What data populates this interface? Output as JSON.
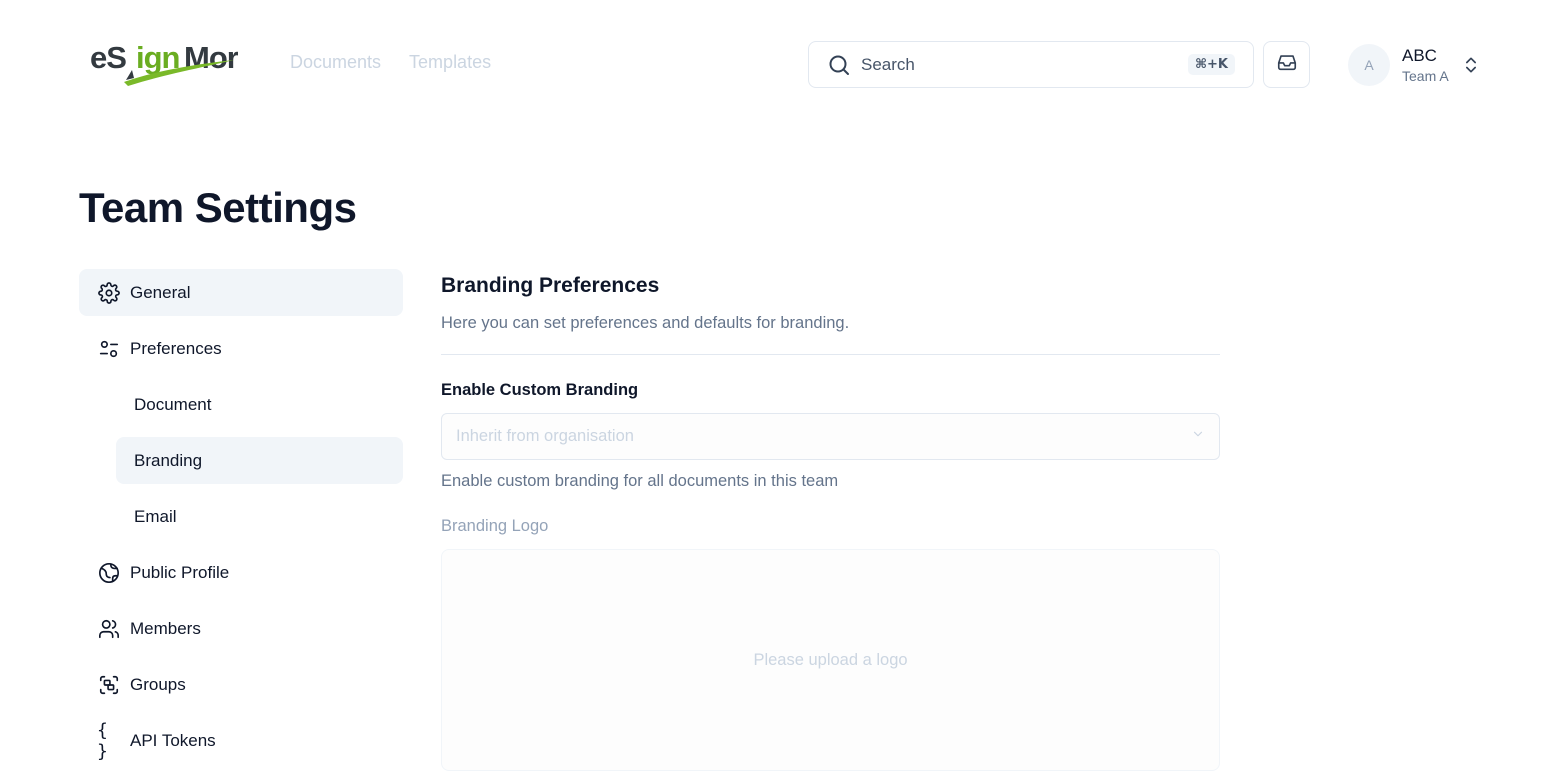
{
  "header": {
    "logo_text": "eSignMor",
    "nav": [
      {
        "label": "Documents"
      },
      {
        "label": "Templates"
      }
    ],
    "search": {
      "label": "Search",
      "shortcut": "⌘+K"
    },
    "account": {
      "avatar_initial": "A",
      "name": "ABC",
      "team": "Team A"
    }
  },
  "page": {
    "title": "Team Settings"
  },
  "sidebar": {
    "items": [
      {
        "label": "General",
        "icon": "gear-icon"
      },
      {
        "label": "Preferences",
        "icon": "sliders-icon"
      },
      {
        "label": "Document"
      },
      {
        "label": "Branding"
      },
      {
        "label": "Email"
      },
      {
        "label": "Public Profile",
        "icon": "globe-icon"
      },
      {
        "label": "Members",
        "icon": "users-icon"
      },
      {
        "label": "Groups",
        "icon": "groups-icon"
      },
      {
        "label": "API Tokens",
        "icon": "braces-icon",
        "icon_glyph": "{ }"
      }
    ]
  },
  "main": {
    "section_title": "Branding Preferences",
    "section_description": "Here you can set preferences and defaults for branding.",
    "custom_branding": {
      "label": "Enable Custom Branding",
      "value": "Inherit from organisation",
      "help": "Enable custom branding for all documents in this team"
    },
    "branding_logo": {
      "label": "Branding Logo",
      "placeholder": "Please upload a logo"
    }
  },
  "colors": {
    "brand_green": "#7ab929",
    "text_primary": "#0f172a",
    "text_muted": "#64748b",
    "active_bg": "#f1f5f9",
    "border": "#e2e8f0"
  }
}
